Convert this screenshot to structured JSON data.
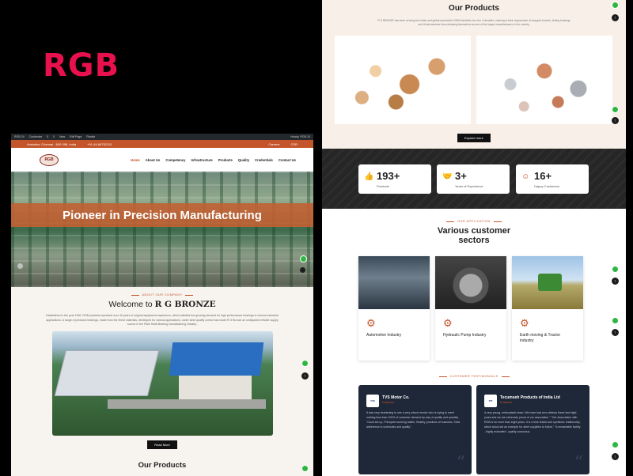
{
  "brand": "RGB",
  "left": {
    "wp_bar": {
      "items": [
        "RGB-24",
        "Customize",
        "5",
        "0",
        "New",
        "Edit Page",
        "Rankie"
      ],
      "greeting": "Howdy, RGB-24"
    },
    "topbar": {
      "address": "Ambattur, Chennai - 600 098, India",
      "phone": "+91-44-66752131",
      "careers": "Careers",
      "csr": "CSR"
    },
    "logo_text": "RGB",
    "menu": [
      "Home",
      "About Us",
      "Competency",
      "Infrastructure",
      "Products",
      "Quality",
      "Credentials",
      "Contact Us"
    ],
    "hero_title": "Pioneer in Precision Manufacturing",
    "about": {
      "kicker": "ABOUT OUR COMPANY",
      "title_prefix": "Welcome to ",
      "title_brand": "R G BRONZE",
      "text": "Established in the year 1982, RGB products represent over 40 years of original equipment experience, which satisfies the growing demand for high performance bearings in various industrial applications. A range of precision bearings, made from the finest materials, developed for various applications, under strict quality control has made R G Bronze an undisputed reliable supply source in the Plain Shaft Bearing manufacturing industry.",
      "button": "Read More"
    },
    "products_title": "Our Products"
  },
  "right": {
    "products": {
      "title": "Our Products",
      "subtitle": "R G BRONZE has been serving the Indian and global automotive OEM industries for over 4 decades, catering to their requirement of wrapped bushes, sliding bearings and thrust washers thus releasing themselves as one of the largest manufacturers in the country.",
      "button": "Explore more"
    },
    "stats": [
      {
        "num": "193+",
        "label": "Products",
        "icon": "thumbs-up-icon"
      },
      {
        "num": "3+",
        "label": "Years of Experience",
        "icon": "handshake-icon"
      },
      {
        "num": "16+",
        "label": "Happy Customers",
        "icon": "smile-icon"
      }
    ],
    "sectors": {
      "kicker": "OUR APPLICATION",
      "title_line1": "Various customer",
      "title_line2": "sectors",
      "cards": [
        {
          "label": "Automotive Industry",
          "icon": "factory-icon"
        },
        {
          "label": "Hydraulic Pump Industry",
          "icon": "gear-hand-icon"
        },
        {
          "label": "Earth moving & Tractor industry",
          "icon": "engine-icon"
        }
      ]
    },
    "testimonials": {
      "kicker": "CUSTOMER TESTIMONIALS",
      "items": [
        {
          "logo": "TVS",
          "name": "TVS Motor Co.",
          "role": "Customer",
          "text": "It was very heartening to see a very robust vendor who is trying to meet nothing less than 100% of customer demand by way of quality and quantity. \"Good set up, Principled working habits, Healthy practices of business, Strict adherence to schedules and quality.\""
        },
        {
          "logo": "TPI",
          "name": "Tecumseh Products of India Ltd",
          "role": "Customer",
          "text": "A very young, enthusiastic team. We have had zero defects these last eight years and we are extremely proud of our association.\" \"Our Association with RGB is for more than eight years. It is a time tested and symbiotic relationship, which stood set an example for other suppliers to follow.\" \"A remarkable facility - highly motivated - quality conscious."
        }
      ]
    }
  }
}
